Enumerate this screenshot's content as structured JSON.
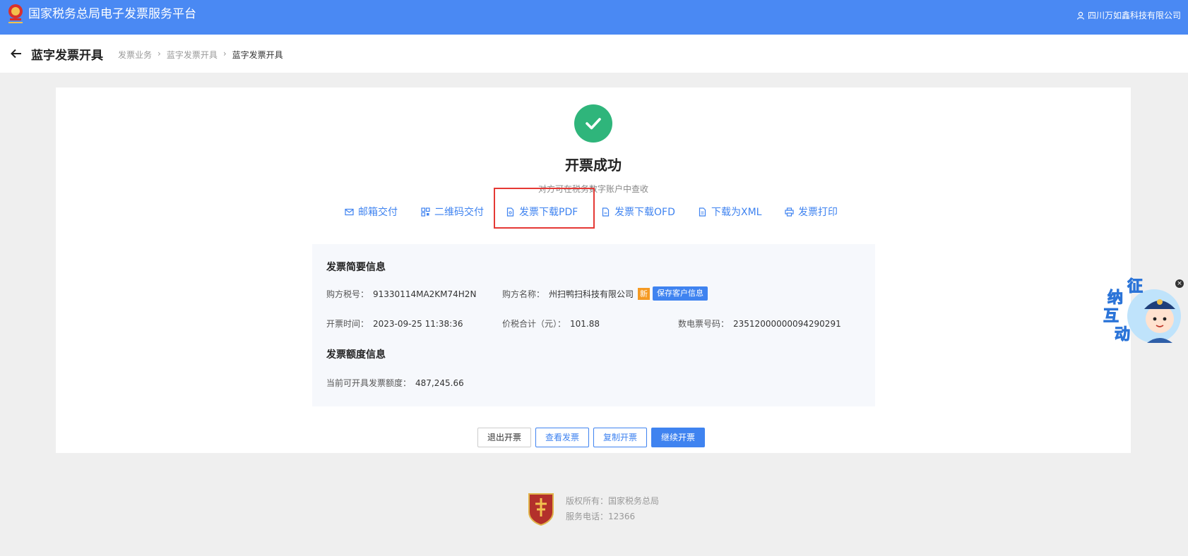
{
  "topbar": {
    "title": "国家税务总局电子发票服务平台",
    "user": "四川万如鑫科技有限公司"
  },
  "subhead": {
    "title": "蓝字发票开具",
    "breadcrumb": [
      "发票业务",
      "蓝字发票开具",
      "蓝字发票开具"
    ]
  },
  "result": {
    "title": "开票成功",
    "subtitle": "对方可在税务数字账户中查收"
  },
  "actions": [
    {
      "label": "邮箱交付",
      "icon": "mail-icon"
    },
    {
      "label": "二维码交付",
      "icon": "qrcode-icon"
    },
    {
      "label": "发票下载PDF",
      "icon": "pdf-file-icon"
    },
    {
      "label": "发票下载OFD",
      "icon": "ofd-file-icon"
    },
    {
      "label": "下载为XML",
      "icon": "xml-file-icon"
    },
    {
      "label": "发票打印",
      "icon": "printer-icon"
    }
  ],
  "summary": {
    "title": "发票简要信息",
    "buyer_tax_label": "购方税号：",
    "buyer_tax": "91330114MA2KM74H2N",
    "buyer_name_label": "购方名称：",
    "buyer_name": "州扫鸭扫科技有限公司",
    "new_tag": "新",
    "save_btn": "保存客户信息",
    "issue_time_label": "开票时间：",
    "issue_time": "2023-09-25 11:38:36",
    "total_label": "价税合计（元）：",
    "total": "101.88",
    "invoice_no_label": "数电票号码：",
    "invoice_no": "23512000000094290291"
  },
  "quota": {
    "title": "发票额度信息",
    "label": "当前可开具发票额度：",
    "value": "487,245.66"
  },
  "buttons": {
    "exit": "退出开票",
    "view": "查看发票",
    "copy": "复制开票",
    "continue": "继续开票"
  },
  "footer": {
    "copyright": "版权所有：国家税务总局",
    "phone": "服务电话：12366"
  },
  "assistant": {
    "text": [
      "征",
      "纳",
      "互",
      "动"
    ]
  },
  "colors": {
    "brand": "#4a89f3",
    "success": "#2fb57b",
    "link": "#3f83f0",
    "highlight": "#e53935"
  }
}
